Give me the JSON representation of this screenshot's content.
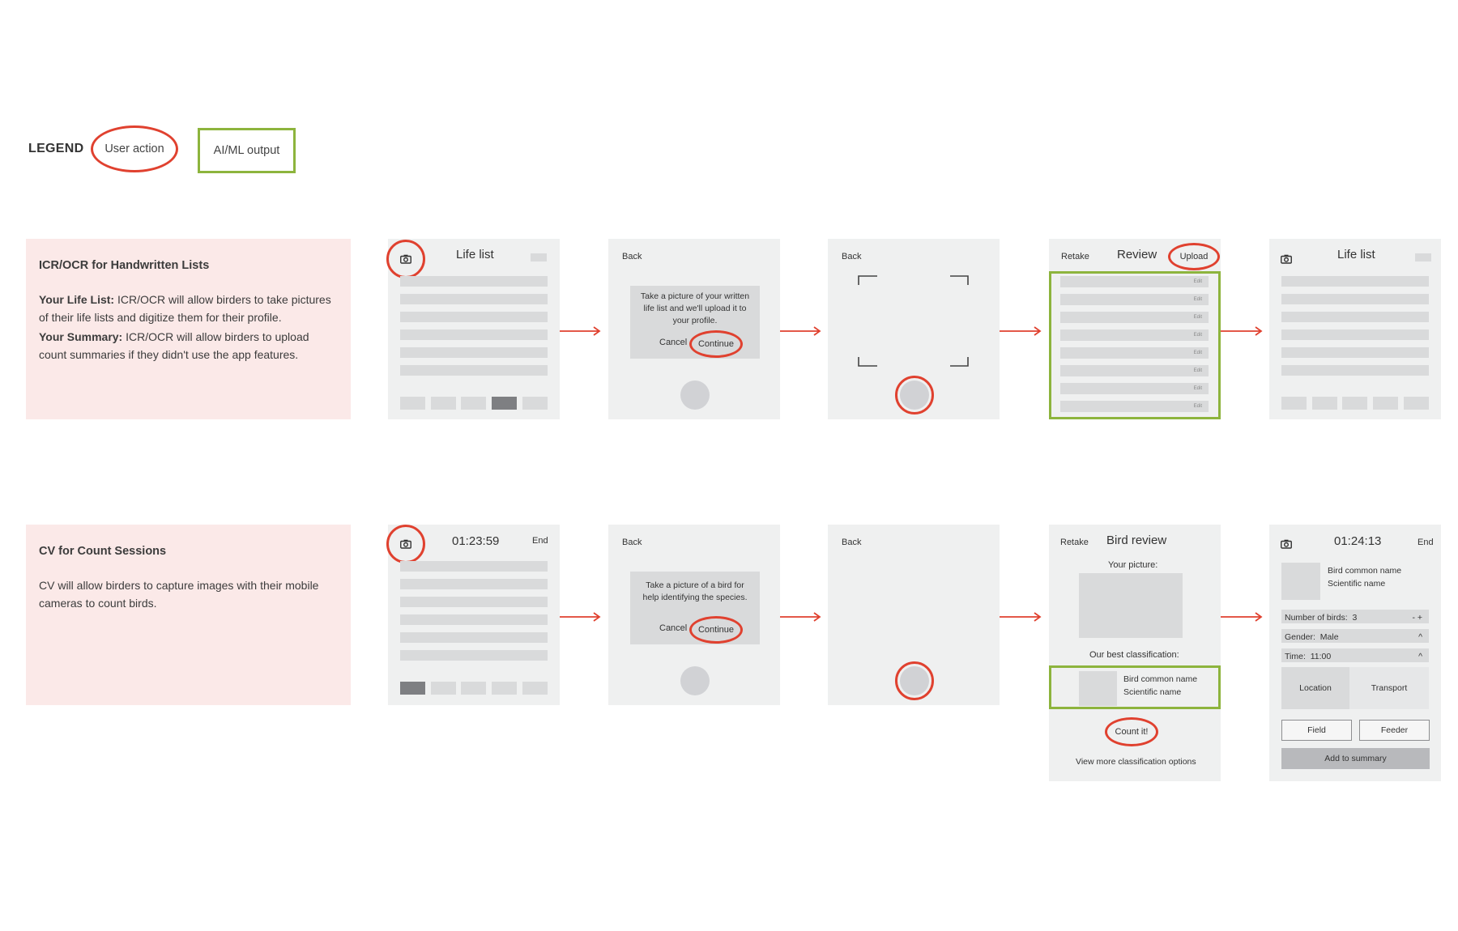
{
  "legend": {
    "label": "LEGEND",
    "user_action": "User action",
    "ai_output": "AI/ML output"
  },
  "colors": {
    "user_action": "#e0412f",
    "ai_output": "#8db43d",
    "panel_bg": "#fbe9e8",
    "screen_bg": "#eff0f0",
    "bar": "#d9dadb"
  },
  "row1": {
    "title": "ICR/OCR for Handwritten Lists",
    "life_list_label": "Your Life List:",
    "life_list_text": " ICR/OCR will allow birders to take pictures of their life lists and digitize them for their profile.",
    "summary_label": "Your Summary:",
    "summary_text": " ICR/OCR will allow birders to upload count summaries if they didn't use the app features.",
    "s1_title": "Life list",
    "s2_back": "Back",
    "s2_dialog": "Take a picture of your written life list and we'll upload it to your profile.",
    "s2_cancel": "Cancel",
    "s2_continue": "Continue",
    "s3_back": "Back",
    "s4_retake": "Retake",
    "s4_title": "Review",
    "s4_upload": "Upload",
    "s4_edit": "Edit",
    "s5_title": "Life list"
  },
  "row2": {
    "title": "CV for Count Sessions",
    "text": "CV will allow birders to capture images with their mobile cameras to count birds.",
    "s1_timer": "01:23:59",
    "s1_end": "End",
    "s2_back": "Back",
    "s2_dialog": "Take a picture of a bird for help identifying the species.",
    "s2_cancel": "Cancel",
    "s2_continue": "Continue",
    "s3_back": "Back",
    "s4_retake": "Retake",
    "s4_title": "Bird review",
    "s4_your_picture": "Your picture:",
    "s4_best": "Our best classification:",
    "s4_common": "Bird common name",
    "s4_scientific": "Scientific name",
    "s4_count": "Count it!",
    "s4_more": "View more classification options",
    "s5_timer": "01:24:13",
    "s5_end": "End",
    "s5_common": "Bird common name",
    "s5_scientific": "Scientific name",
    "s5_num_label": "Number of birds:",
    "s5_num_value": "3",
    "s5_stepper": "- +",
    "s5_gender_label": "Gender:",
    "s5_gender_value": "Male",
    "s5_time_label": "Time:",
    "s5_time_value": "11:00",
    "s5_caret": "^",
    "s5_location": "Location",
    "s5_transport": "Transport",
    "s5_field": "Field",
    "s5_feeder": "Feeder",
    "s5_add": "Add to summary"
  }
}
